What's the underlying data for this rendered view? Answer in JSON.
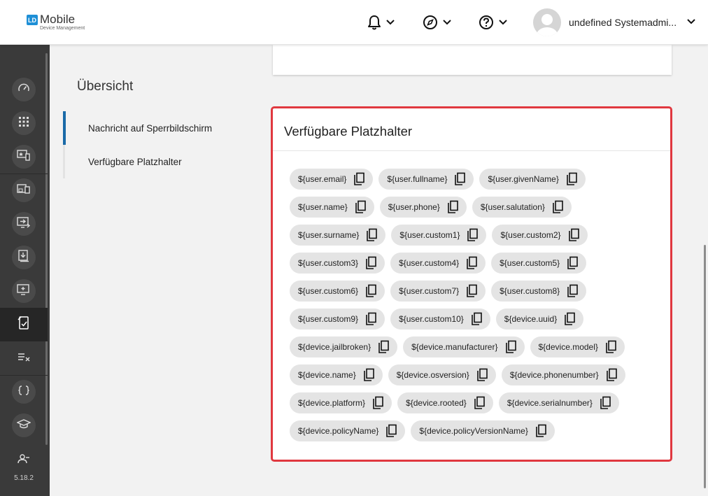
{
  "app": {
    "logo_badge": "LD",
    "logo_title": "Mobile",
    "logo_subtitle": "Device Management",
    "version": "5.18.2"
  },
  "header": {
    "user_name": "undefined Systemadmi..."
  },
  "sidebar": {
    "icons": [
      "dashboard-icon",
      "apps-grid-icon",
      "device-star-icon",
      "devices-icon",
      "device-arrow-icon",
      "download-device-icon",
      "monitor-add-icon",
      "device-policy-icon",
      "list-check-icon",
      "braces-icon",
      "graduation-icon",
      "user-group-icon"
    ]
  },
  "page": {
    "section_title": "Übersicht",
    "nav": [
      "Nachricht auf Sperrbildschirm",
      "Verfügbare Platzhalter"
    ]
  },
  "card": {
    "title": "Verfügbare Platzhalter",
    "placeholders": [
      "${user.email}",
      "${user.fullname}",
      "${user.givenName}",
      "${user.name}",
      "${user.phone}",
      "${user.salutation}",
      "${user.surname}",
      "${user.custom1}",
      "${user.custom2}",
      "${user.custom3}",
      "${user.custom4}",
      "${user.custom5}",
      "${user.custom6}",
      "${user.custom7}",
      "${user.custom8}",
      "${user.custom9}",
      "${user.custom10}",
      "${device.uuid}",
      "${device.jailbroken}",
      "${device.manufacturer}",
      "${device.model}",
      "${device.name}",
      "${device.osversion}",
      "${device.phonenumber}",
      "${device.platform}",
      "${device.rooted}",
      "${device.serialnumber}",
      "${device.policyName}",
      "${device.policyVersionName}"
    ]
  },
  "colors": {
    "accent": "#1a6aa8",
    "highlight_border": "#e0383f",
    "sidebar_bg": "#3a3a3a"
  }
}
